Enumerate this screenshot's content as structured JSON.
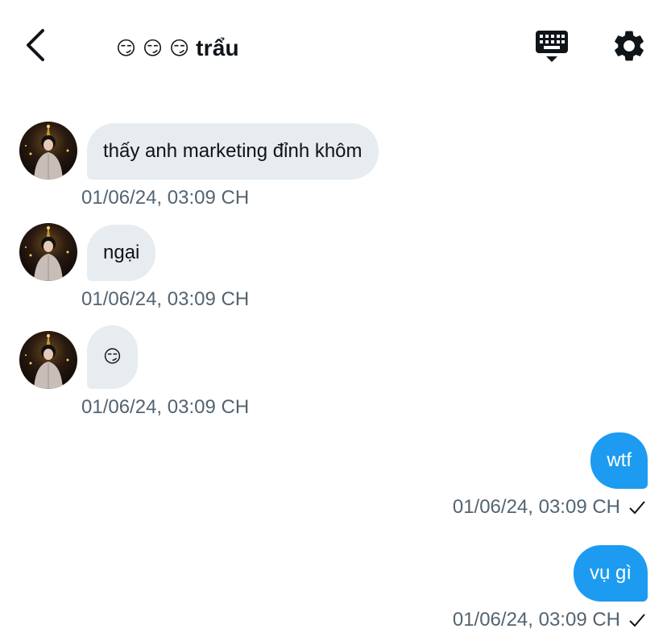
{
  "header": {
    "title_emojis": [
      "😏",
      "😏",
      "😏"
    ],
    "title": "trẩu",
    "back_icon": "chevron-left-icon",
    "keyboard_icon": "keyboard-icon",
    "settings_icon": "gear-icon"
  },
  "colors": {
    "incoming_bubble": "#e7ecf0",
    "outgoing_bubble": "#1d9bf0",
    "timestamp": "#536471"
  },
  "messages": [
    {
      "direction": "in",
      "text": "thấy anh marketing đỉnh khôm",
      "time": "01/06/24, 03:09 CH"
    },
    {
      "direction": "in",
      "text": "ngại",
      "time": "01/06/24, 03:09 CH"
    },
    {
      "direction": "in",
      "text": "😏",
      "time": "01/06/24, 03:09 CH"
    },
    {
      "direction": "out",
      "text": "wtf",
      "time": "01/06/24, 03:09 CH",
      "status": "sent-check-icon"
    },
    {
      "direction": "out",
      "text": "vụ gì",
      "time": "01/06/24, 03:09 CH",
      "status": "sent-check-icon"
    }
  ]
}
